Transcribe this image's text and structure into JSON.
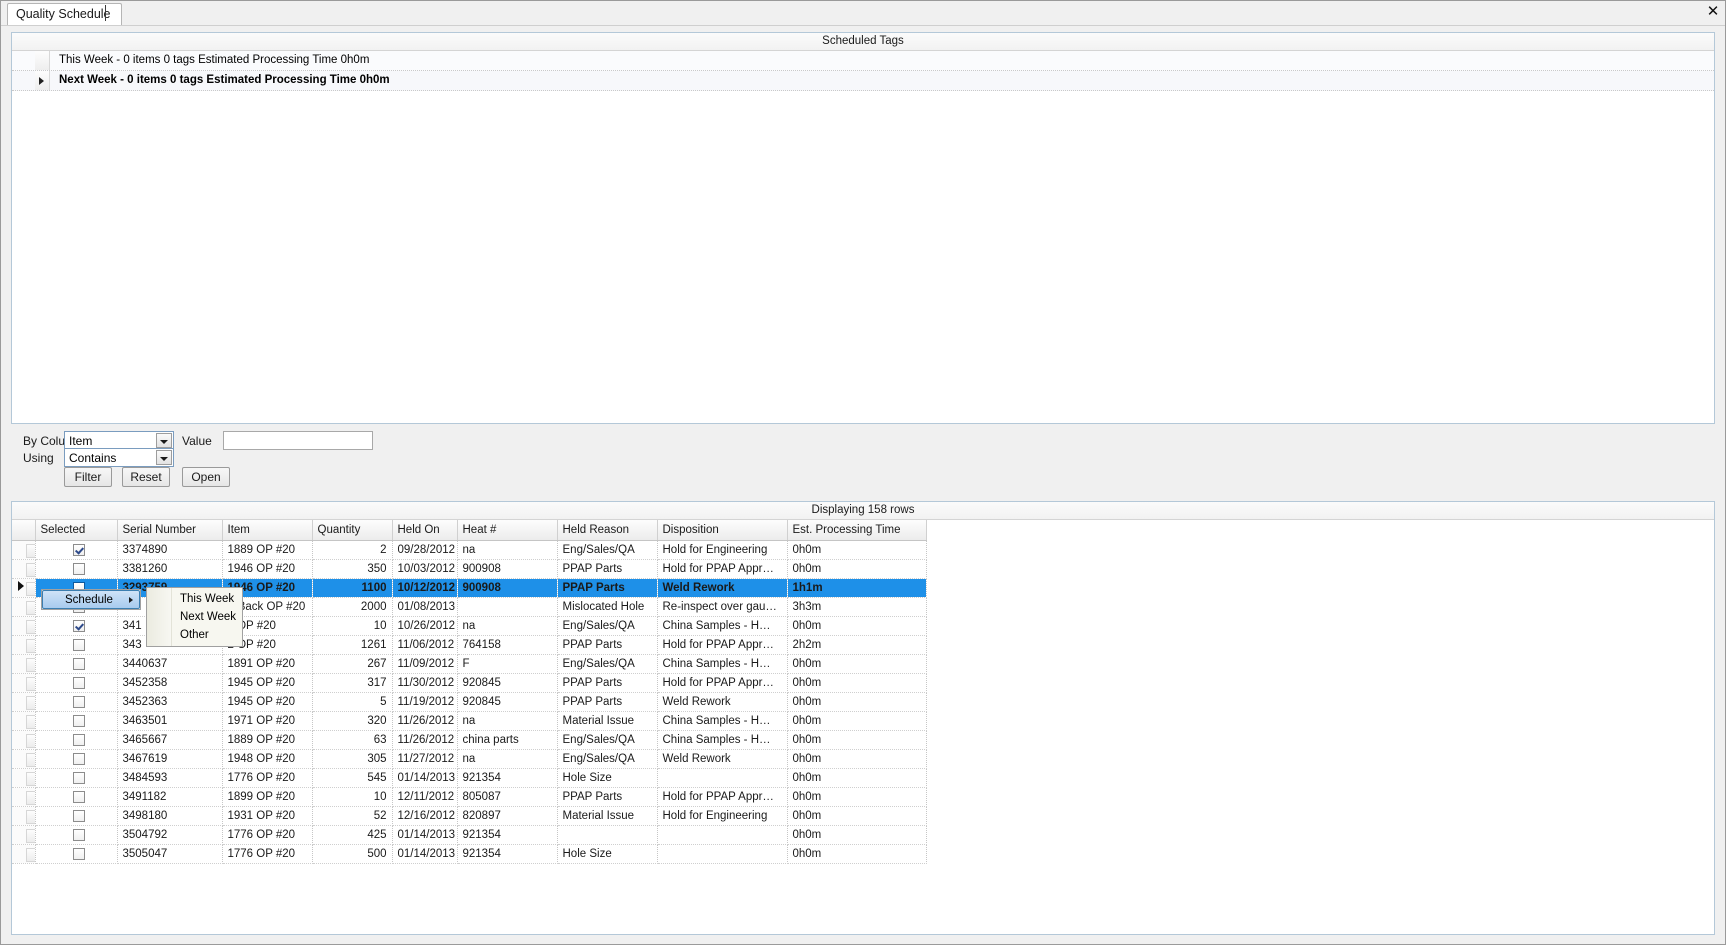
{
  "window": {
    "tab_label": "Quality Schedule",
    "close_icon": "close-icon"
  },
  "scheduled_panel": {
    "caption": "Scheduled Tags",
    "rows": [
      {
        "label": "This Week - 0 items 0 tags  Estimated Processing Time 0h0m",
        "bold": false,
        "expanded": false,
        "has_arrow": false
      },
      {
        "label": "Next Week - 0 items 0 tags  Estimated Processing Time 0h0m",
        "bold": true,
        "expanded": false,
        "has_arrow": true
      }
    ]
  },
  "filter": {
    "by_column_label": "By Colu",
    "using_label": "Using",
    "value_label": "Value",
    "column_select_value": "Item",
    "operator_select_value": "Contains",
    "value_input_value": "",
    "value_input_placeholder": "",
    "filter_button": "Filter",
    "reset_button": "Reset",
    "open_button": "Open"
  },
  "grid": {
    "caption": "Displaying 158 rows",
    "columns": [
      "Selected",
      "Serial Number",
      "Item",
      "Quantity",
      "Held On",
      "Heat #",
      "Held Reason",
      "Disposition",
      "Est. Processing Time"
    ],
    "rows": [
      {
        "selected_checkbox": true,
        "serial": "3374890",
        "item": "1889 OP #20",
        "quantity": "2",
        "held_on": "09/28/2012",
        "heat": "na",
        "reason": "Eng/Sales/QA",
        "disposition": "Hold for Engineering",
        "est_time": "0h0m",
        "highlighted": false,
        "marker": false
      },
      {
        "selected_checkbox": false,
        "serial": "3381260",
        "item": "1946 OP #20",
        "quantity": "350",
        "held_on": "10/03/2012",
        "heat": "900908",
        "reason": "PPAP Parts",
        "disposition": "Hold for  PPAP Appr…",
        "est_time": "0h0m",
        "highlighted": false,
        "marker": false
      },
      {
        "selected_checkbox": false,
        "serial": "3293759",
        "item": "1946 OP #20",
        "quantity": "1100",
        "held_on": "10/12/2012",
        "heat": "900908",
        "reason": "PPAP Parts",
        "disposition": "Weld Rework",
        "est_time": "1h1m",
        "highlighted": true,
        "marker": true
      },
      {
        "selected_checkbox": false,
        "serial": "",
        "item": "7-Back OP #20",
        "quantity": "2000",
        "held_on": "01/08/2013",
        "heat": "",
        "reason": "Mislocated Hole",
        "disposition": "Re-inspect over gau…",
        "est_time": "3h3m",
        "highlighted": false,
        "marker": false
      },
      {
        "selected_checkbox": true,
        "serial": "341",
        "item": "5 OP #20",
        "quantity": "10",
        "held_on": "10/26/2012",
        "heat": "na",
        "reason": "Eng/Sales/QA",
        "disposition": "China Samples - H…",
        "est_time": "0h0m",
        "highlighted": false,
        "marker": false
      },
      {
        "selected_checkbox": false,
        "serial": "343",
        "item": "2 OP #20",
        "quantity": "1261",
        "held_on": "11/06/2012",
        "heat": "764158",
        "reason": "PPAP Parts",
        "disposition": "Hold for  PPAP Appr…",
        "est_time": "2h2m",
        "highlighted": false,
        "marker": false
      },
      {
        "selected_checkbox": false,
        "serial": "3440637",
        "item": "1891 OP #20",
        "quantity": "267",
        "held_on": "11/09/2012",
        "heat": "F",
        "reason": "Eng/Sales/QA",
        "disposition": "China Samples - H…",
        "est_time": "0h0m",
        "highlighted": false,
        "marker": false
      },
      {
        "selected_checkbox": false,
        "serial": "3452358",
        "item": "1945 OP #20",
        "quantity": "317",
        "held_on": "11/30/2012",
        "heat": "920845",
        "reason": "PPAP Parts",
        "disposition": "Hold for  PPAP Appr…",
        "est_time": "0h0m",
        "highlighted": false,
        "marker": false
      },
      {
        "selected_checkbox": false,
        "serial": "3452363",
        "item": "1945 OP #20",
        "quantity": "5",
        "held_on": "11/19/2012",
        "heat": "920845",
        "reason": "PPAP Parts",
        "disposition": "Weld Rework",
        "est_time": "0h0m",
        "highlighted": false,
        "marker": false
      },
      {
        "selected_checkbox": false,
        "serial": "3463501",
        "item": "1971 OP #20",
        "quantity": "320",
        "held_on": "11/26/2012",
        "heat": "na",
        "reason": "Material Issue",
        "disposition": "China Samples - H…",
        "est_time": "0h0m",
        "highlighted": false,
        "marker": false
      },
      {
        "selected_checkbox": false,
        "serial": "3465667",
        "item": "1889 OP #20",
        "quantity": "63",
        "held_on": "11/26/2012",
        "heat": "china parts",
        "reason": "Eng/Sales/QA",
        "disposition": "China Samples - H…",
        "est_time": "0h0m",
        "highlighted": false,
        "marker": false
      },
      {
        "selected_checkbox": false,
        "serial": "3467619",
        "item": "1948 OP #20",
        "quantity": "305",
        "held_on": "11/27/2012",
        "heat": "na",
        "reason": "Eng/Sales/QA",
        "disposition": "Weld Rework",
        "est_time": "0h0m",
        "highlighted": false,
        "marker": false
      },
      {
        "selected_checkbox": false,
        "serial": "3484593",
        "item": "1776 OP #20",
        "quantity": "545",
        "held_on": "01/14/2013",
        "heat": "921354",
        "reason": "Hole Size",
        "disposition": "",
        "est_time": "0h0m",
        "highlighted": false,
        "marker": false
      },
      {
        "selected_checkbox": false,
        "serial": "3491182",
        "item": "1899 OP #20",
        "quantity": "10",
        "held_on": "12/11/2012",
        "heat": "805087",
        "reason": "PPAP Parts",
        "disposition": "Hold for  PPAP Appr…",
        "est_time": "0h0m",
        "highlighted": false,
        "marker": false
      },
      {
        "selected_checkbox": false,
        "serial": "3498180",
        "item": "1931 OP #20",
        "quantity": "52",
        "held_on": "12/16/2012",
        "heat": "820897",
        "reason": "Material Issue",
        "disposition": "Hold for Engineering",
        "est_time": "0h0m",
        "highlighted": false,
        "marker": false
      },
      {
        "selected_checkbox": false,
        "serial": "3504792",
        "item": "1776 OP #20",
        "quantity": "425",
        "held_on": "01/14/2013",
        "heat": "921354",
        "reason": "",
        "disposition": "",
        "est_time": "0h0m",
        "highlighted": false,
        "marker": false
      },
      {
        "selected_checkbox": false,
        "serial": "3505047",
        "item": "1776 OP #20",
        "quantity": "500",
        "held_on": "01/14/2013",
        "heat": "921354",
        "reason": "Hole Size",
        "disposition": "",
        "est_time": "0h0m",
        "highlighted": false,
        "marker": false
      }
    ]
  },
  "context_menu": {
    "items": [
      {
        "label": "Schedule",
        "has_submenu": true,
        "active": true
      }
    ],
    "submenu": {
      "items": [
        {
          "label": "This Week"
        },
        {
          "label": "Next Week"
        },
        {
          "label": "Other"
        }
      ]
    }
  },
  "colors": {
    "selection_blue": "#1e90e8",
    "panel_border": "#b4c8d8",
    "chrome_gray": "#f0f0f0"
  }
}
